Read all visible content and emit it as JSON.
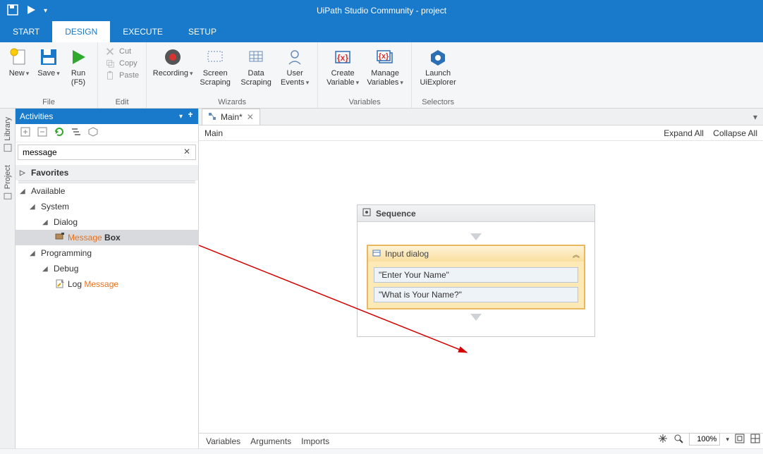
{
  "title": "UiPath Studio Community - project",
  "menutabs": {
    "start": "START",
    "design": "DESIGN",
    "execute": "EXECUTE",
    "setup": "SETUP"
  },
  "ribbon": {
    "file": {
      "group": "File",
      "new": "New",
      "save": "Save",
      "run": "Run",
      "run_sub": "(F5)"
    },
    "edit": {
      "group": "Edit",
      "cut": "Cut",
      "copy": "Copy",
      "paste": "Paste"
    },
    "wizards": {
      "group": "Wizards",
      "recording": "Recording",
      "screen": "Screen\nScraping",
      "data": "Data\nScraping",
      "user": "User\nEvents"
    },
    "variables": {
      "group": "Variables",
      "create": "Create\nVariable",
      "manage": "Manage\nVariables"
    },
    "selectors": {
      "group": "Selectors",
      "launch": "Launch\nUiExplorer"
    }
  },
  "vtabs": {
    "library": "Library",
    "project": "Project"
  },
  "activities": {
    "title": "Activities",
    "search": "message",
    "favorites": "Favorites",
    "available": "Available",
    "system": "System",
    "dialog": "Dialog",
    "messagebox_pre": "Message",
    "messagebox_suf": " Box",
    "programming": "Programming",
    "debug": "Debug",
    "log_pre": "Log ",
    "log_suf": "Message"
  },
  "doc": {
    "tab": "Main*",
    "breadcrumb": "Main",
    "expand": "Expand All",
    "collapse": "Collapse All"
  },
  "sequence": {
    "title": "Sequence"
  },
  "inputdialog": {
    "title": "Input dialog",
    "field1": "\"Enter Your Name\"",
    "field2": "\"What is Your Name?\""
  },
  "bottom": {
    "variables": "Variables",
    "arguments": "Arguments",
    "imports": "Imports"
  },
  "zoom": "100%"
}
